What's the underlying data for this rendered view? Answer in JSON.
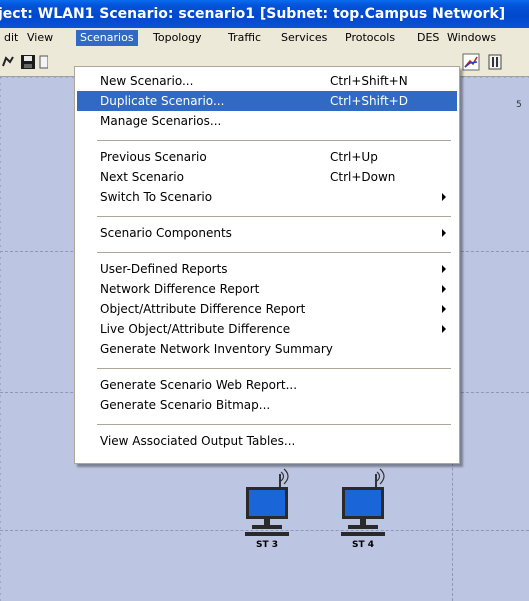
{
  "window": {
    "title": "ject: WLAN1 Scenario: scenario1  [Subnet: top.Campus Network]"
  },
  "menubar": {
    "items": [
      "dit",
      "View",
      "Scenarios",
      "Topology",
      "Traffic",
      "Services",
      "Protocols",
      "DES",
      "Windows"
    ],
    "active": "Scenarios"
  },
  "canvas": {
    "corner_label": "5",
    "nodes": [
      {
        "label": "ST 3"
      },
      {
        "label": "ST 4"
      }
    ]
  },
  "scenarios_menu": {
    "items": [
      {
        "label": "New Scenario...",
        "shortcut": "Ctrl+Shift+N"
      },
      {
        "label": "Duplicate Scenario...",
        "shortcut": "Ctrl+Shift+D",
        "highlighted": true
      },
      {
        "label": "Manage Scenarios...",
        "shortcut": ""
      },
      {
        "label": "Previous Scenario",
        "shortcut": "Ctrl+Up"
      },
      {
        "label": "Next Scenario",
        "shortcut": "Ctrl+Down"
      },
      {
        "label": "Switch To Scenario",
        "shortcut": "",
        "submenu": true
      },
      {
        "label": "Scenario Components",
        "shortcut": "",
        "submenu": true
      },
      {
        "label": "User-Defined Reports",
        "shortcut": "",
        "submenu": true
      },
      {
        "label": "Network Difference Report",
        "shortcut": "",
        "submenu": true
      },
      {
        "label": "Object/Attribute Difference Report",
        "shortcut": "",
        "submenu": true
      },
      {
        "label": "Live Object/Attribute Difference",
        "shortcut": "",
        "submenu": true
      },
      {
        "label": "Generate Network Inventory Summary",
        "shortcut": ""
      },
      {
        "label": "Generate Scenario Web Report...",
        "shortcut": ""
      },
      {
        "label": "Generate Scenario Bitmap...",
        "shortcut": ""
      },
      {
        "label": "View Associated Output Tables...",
        "shortcut": ""
      }
    ]
  },
  "colors": {
    "title_bar": "#0048cc",
    "menu_highlight": "#316ac5",
    "canvas": "#bcc6e2",
    "monitor": "#1a66d8"
  }
}
